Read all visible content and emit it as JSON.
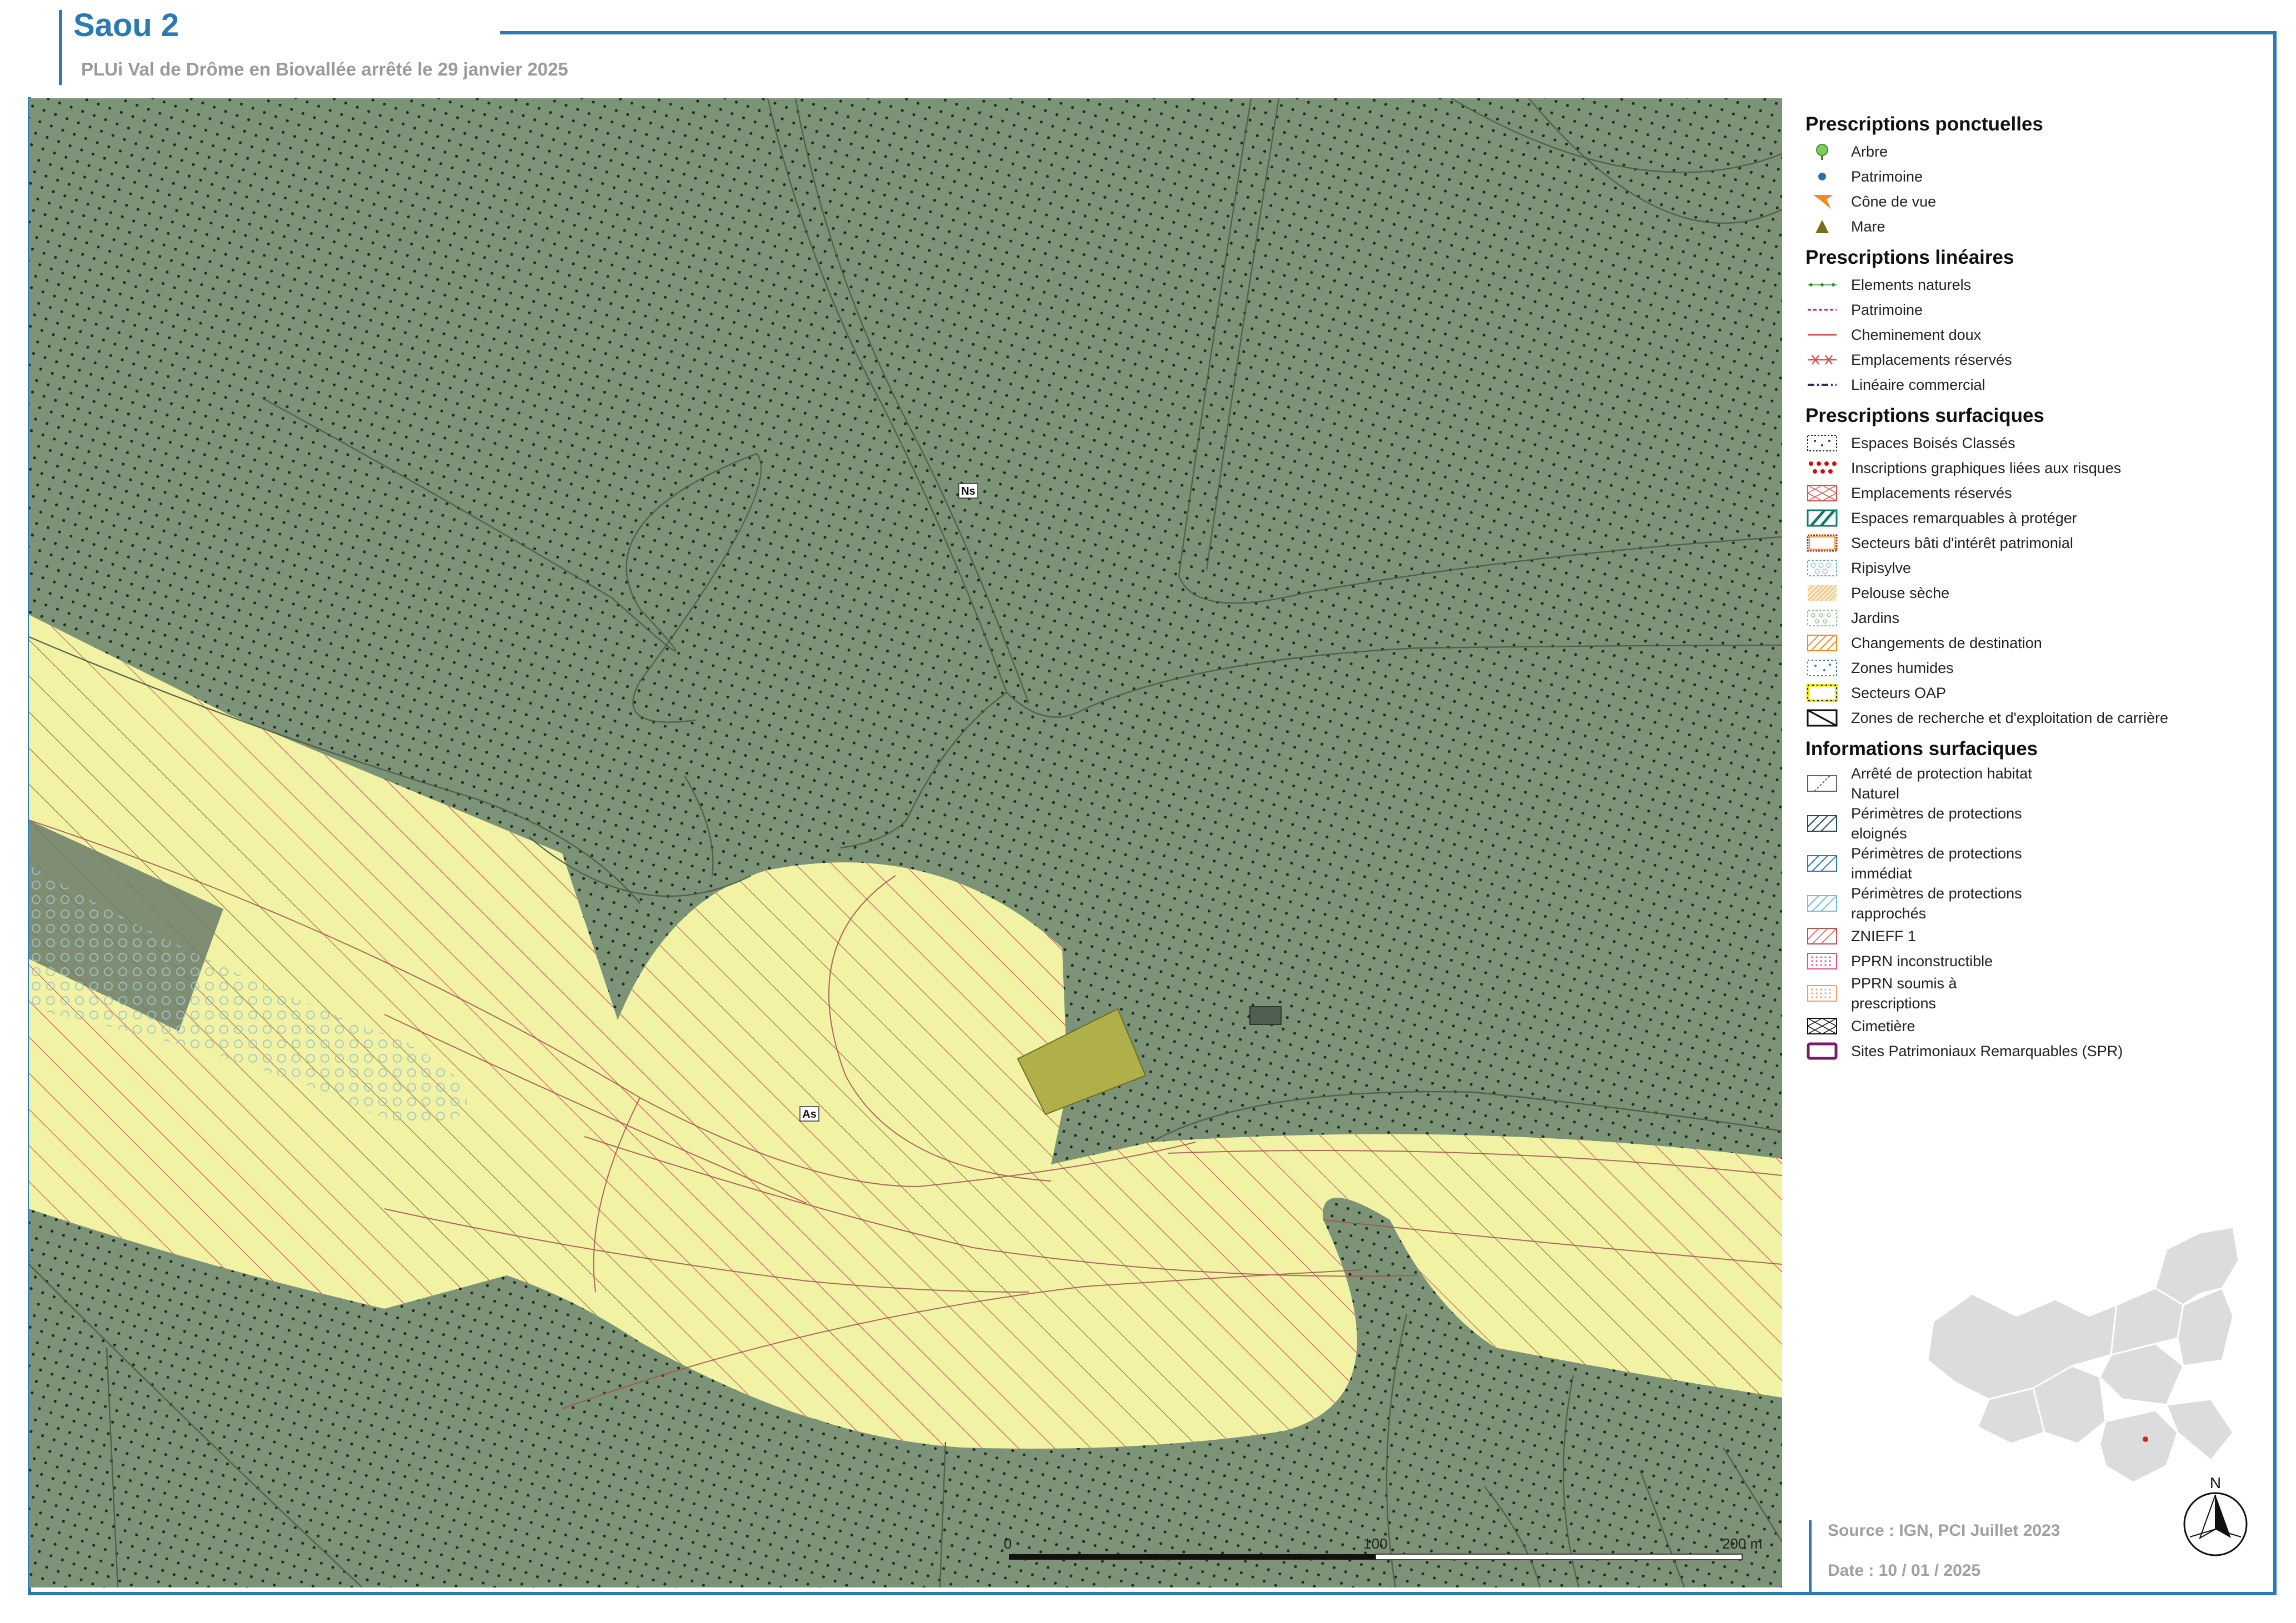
{
  "header": {
    "title": "Saou 2",
    "subtitle": "PLUi Val de Drôme en Biovallée arrêté le 29 janvier 2025"
  },
  "map": {
    "zone_labels": [
      "Ns",
      "As"
    ],
    "colors": {
      "zone_n": "#7d9378",
      "zone_a": "#f2f2a4",
      "hatch": "#c0504d",
      "dots": "#1f2d1f",
      "paths": "#4d5a48",
      "dark_parcel": "#5a6a5a",
      "olive_parcel": "#b0b04a"
    },
    "scale": {
      "labels": [
        "0",
        "100",
        "200 m"
      ]
    }
  },
  "legend": {
    "sections": [
      {
        "title": "Prescriptions ponctuelles",
        "items": [
          {
            "label": "Arbre",
            "icon": "tree-icon"
          },
          {
            "label": "Patrimoine",
            "icon": "dot-icon"
          },
          {
            "label": "Cône de vue",
            "icon": "view-cone-icon"
          },
          {
            "label": "Mare",
            "icon": "triangle-icon"
          }
        ]
      },
      {
        "title": "Prescriptions linéaires",
        "items": [
          {
            "label": "Elements naturels",
            "icon": "line-dotted-green"
          },
          {
            "label": "Patrimoine",
            "icon": "line-dashed-magenta"
          },
          {
            "label": "Cheminement doux",
            "icon": "line-solid-red"
          },
          {
            "label": "Emplacements réservés",
            "icon": "line-cross-red"
          },
          {
            "label": "Linéaire commercial",
            "icon": "line-dashdot-navy"
          }
        ]
      },
      {
        "title": "Prescriptions surfaciques",
        "items": [
          {
            "label": "Espaces Boisés Classés",
            "icon": "box-dots-green"
          },
          {
            "label": "Inscriptions graphiques liées aux risques",
            "icon": "box-red-dots"
          },
          {
            "label": "Emplacements réservés",
            "icon": "box-red-cross"
          },
          {
            "label": "Espaces remarquables à protéger",
            "icon": "box-teal-hatch"
          },
          {
            "label": "Secteurs bâti d'intérêt patrimonial",
            "icon": "box-orange-dotted"
          },
          {
            "label": "Ripisylve",
            "icon": "box-blue-circles"
          },
          {
            "label": "Pelouse sèche",
            "icon": "box-tan-hatch"
          },
          {
            "label": "Jardins",
            "icon": "box-green-circles"
          },
          {
            "label": "Changements de destination",
            "icon": "box-orange-hatch"
          },
          {
            "label": "Zones humides",
            "icon": "box-blue-dots"
          },
          {
            "label": "Secteurs OAP",
            "icon": "box-yellow-dotted"
          },
          {
            "label": "Zones de recherche et d'exploitation de carrière",
            "icon": "box-black-hatch"
          }
        ]
      },
      {
        "title": "Informations surfaciques",
        "items": [
          {
            "label": "Arrêté de protection habitat Naturel",
            "icon": "box-purple-hatch"
          },
          {
            "label": "Périmètres de protections eloignés",
            "icon": "box-navy-hatch"
          },
          {
            "label": "Périmètres de protections immédiat",
            "icon": "box-blue-hatch"
          },
          {
            "label": "Périmètres de protections rapprochés",
            "icon": "box-lightblue-hatch"
          },
          {
            "label": "ZNIEFF 1",
            "icon": "box-red-hatch"
          },
          {
            "label": "PPRN inconstructible",
            "icon": "box-pink-dots"
          },
          {
            "label": "PPRN soumis à prescriptions",
            "icon": "box-orange-dots"
          },
          {
            "label": "Cimetière",
            "icon": "box-black-cross"
          },
          {
            "label": "Sites Patrimoniaux Remarquables (SPR)",
            "icon": "box-purple-outline"
          }
        ]
      }
    ]
  },
  "footer": {
    "source": "Source : IGN, PCI Juillet 2023",
    "date": "Date : 10 / 01 / 2025",
    "north_label": "N"
  }
}
